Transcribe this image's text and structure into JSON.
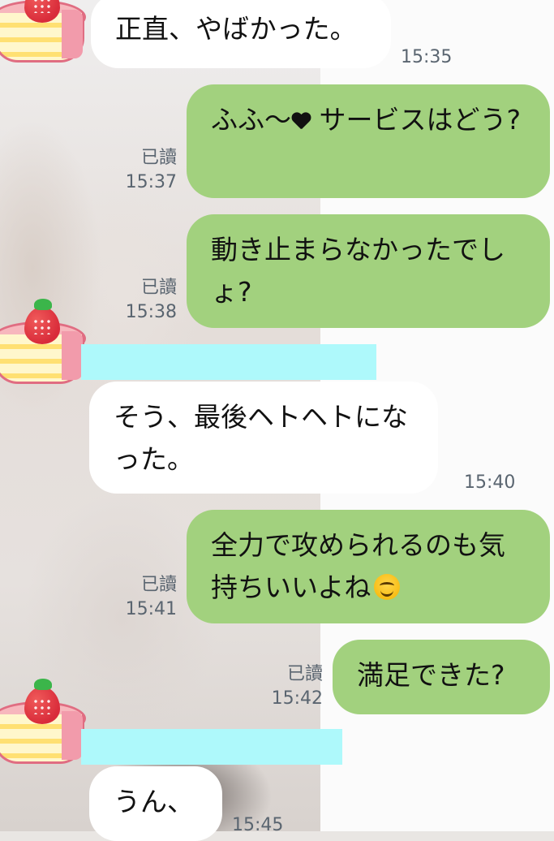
{
  "messages": [
    {
      "side": "in",
      "text": "正直、やばかった。",
      "time": "15:35"
    },
    {
      "side": "out",
      "text_before": "ふふ〜",
      "icon": "heart-icon",
      "text_after": " サービスはどう?",
      "read": "已讀",
      "time": "15:37"
    },
    {
      "side": "out",
      "text": "動き止まらなかったでしょ?",
      "read": "已讀",
      "time": "15:38"
    },
    {
      "side": "in",
      "text": "そう、最後ヘトヘトになった。",
      "time": "15:40"
    },
    {
      "side": "out",
      "text": "全力で攻められるのも気持ちいいよね",
      "icon": "smile-emoji-icon",
      "read": "已讀",
      "time": "15:41"
    },
    {
      "side": "out",
      "text": "満足できた?",
      "read": "已讀",
      "time": "15:42"
    },
    {
      "side": "in",
      "text": "うん、",
      "time": "15:45"
    }
  ],
  "colors": {
    "outgoing_bubble": "#a2d17e",
    "incoming_bubble": "#ffffff",
    "name_redaction": "#aef9fb"
  }
}
